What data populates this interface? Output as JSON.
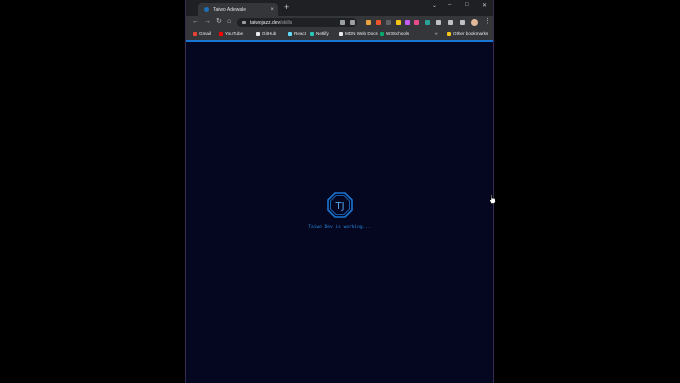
{
  "tab": {
    "title": "Taiwo Adewale",
    "close": "×"
  },
  "newtab": "+",
  "window_controls": {
    "dropdown": "⌄",
    "minimize": "–",
    "maximize": "□",
    "close": "✕"
  },
  "nav": {
    "back": "←",
    "forward": "→",
    "reload": "↻",
    "home": "⌂"
  },
  "address": {
    "host": "taiwojazz.dev",
    "path": "/skills"
  },
  "bookmarks": [
    {
      "label": "Gmail",
      "color": "#ea4335"
    },
    {
      "label": "YouTube",
      "color": "#ff0000"
    },
    {
      "label": "GitHub",
      "color": "#e8eaed"
    },
    {
      "label": "React",
      "color": "#61dafb"
    },
    {
      "label": "Netlify",
      "color": "#25c7b7"
    },
    {
      "label": "MDN Web Docs",
      "color": "#e8eaed"
    },
    {
      "label": "W3Schools",
      "color": "#04aa6d"
    }
  ],
  "bookmarks_more": "»",
  "other_bookmarks": "Other bookmarks",
  "logo_letter": "TJ",
  "loading_text": "Taiwo Dev is working...",
  "colors": {
    "accent": "#1976d2",
    "page_bg": "#050720",
    "loading_text": "#2a8adf"
  }
}
